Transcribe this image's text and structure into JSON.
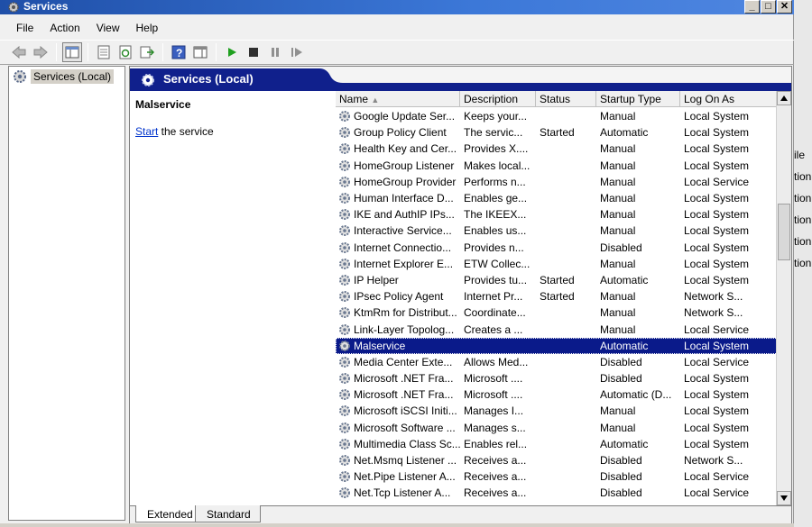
{
  "window": {
    "title": "Services"
  },
  "menu": [
    "File",
    "Action",
    "View",
    "Help"
  ],
  "tree": {
    "root_label": "Services (Local)"
  },
  "panel": {
    "header_title": "Services (Local)",
    "selected_service": "Malservice",
    "action_link": "Start",
    "action_rest": " the service"
  },
  "columns": [
    "Name",
    "Description",
    "Status",
    "Startup Type",
    "Log On As"
  ],
  "rows": [
    {
      "name": "Google Update Ser...",
      "desc": "Keeps your...",
      "status": "",
      "startup": "Manual",
      "logon": "Local System"
    },
    {
      "name": "Group Policy Client",
      "desc": "The servic...",
      "status": "Started",
      "startup": "Automatic",
      "logon": "Local System"
    },
    {
      "name": "Health Key and Cer...",
      "desc": "Provides X....",
      "status": "",
      "startup": "Manual",
      "logon": "Local System"
    },
    {
      "name": "HomeGroup Listener",
      "desc": "Makes local...",
      "status": "",
      "startup": "Manual",
      "logon": "Local System"
    },
    {
      "name": "HomeGroup Provider",
      "desc": "Performs n...",
      "status": "",
      "startup": "Manual",
      "logon": "Local Service"
    },
    {
      "name": "Human Interface D...",
      "desc": "Enables ge...",
      "status": "",
      "startup": "Manual",
      "logon": "Local System"
    },
    {
      "name": "IKE and AuthIP IPs...",
      "desc": "The IKEEX...",
      "status": "",
      "startup": "Manual",
      "logon": "Local System"
    },
    {
      "name": "Interactive Service...",
      "desc": "Enables us...",
      "status": "",
      "startup": "Manual",
      "logon": "Local System"
    },
    {
      "name": "Internet Connectio...",
      "desc": "Provides n...",
      "status": "",
      "startup": "Disabled",
      "logon": "Local System"
    },
    {
      "name": "Internet Explorer E...",
      "desc": "ETW Collec...",
      "status": "",
      "startup": "Manual",
      "logon": "Local System"
    },
    {
      "name": "IP Helper",
      "desc": "Provides tu...",
      "status": "Started",
      "startup": "Automatic",
      "logon": "Local System"
    },
    {
      "name": "IPsec Policy Agent",
      "desc": "Internet Pr...",
      "status": "Started",
      "startup": "Manual",
      "logon": "Network S..."
    },
    {
      "name": "KtmRm for Distribut...",
      "desc": "Coordinate...",
      "status": "",
      "startup": "Manual",
      "logon": "Network S..."
    },
    {
      "name": "Link-Layer Topolog...",
      "desc": "Creates a ...",
      "status": "",
      "startup": "Manual",
      "logon": "Local Service"
    },
    {
      "name": "Malservice",
      "desc": "",
      "status": "",
      "startup": "Automatic",
      "logon": "Local System",
      "selected": true
    },
    {
      "name": "Media Center Exte...",
      "desc": "Allows Med...",
      "status": "",
      "startup": "Disabled",
      "logon": "Local Service"
    },
    {
      "name": "Microsoft .NET Fra...",
      "desc": "Microsoft ....",
      "status": "",
      "startup": "Disabled",
      "logon": "Local System"
    },
    {
      "name": "Microsoft .NET Fra...",
      "desc": "Microsoft ....",
      "status": "",
      "startup": "Automatic (D...",
      "logon": "Local System"
    },
    {
      "name": "Microsoft iSCSI Initi...",
      "desc": "Manages I...",
      "status": "",
      "startup": "Manual",
      "logon": "Local System"
    },
    {
      "name": "Microsoft Software ...",
      "desc": "Manages s...",
      "status": "",
      "startup": "Manual",
      "logon": "Local System"
    },
    {
      "name": "Multimedia Class Sc...",
      "desc": "Enables rel...",
      "status": "",
      "startup": "Automatic",
      "logon": "Local System"
    },
    {
      "name": "Net.Msmq Listener ...",
      "desc": "Receives a...",
      "status": "",
      "startup": "Disabled",
      "logon": "Network S..."
    },
    {
      "name": "Net.Pipe Listener A...",
      "desc": "Receives a...",
      "status": "",
      "startup": "Disabled",
      "logon": "Local Service"
    },
    {
      "name": "Net.Tcp Listener A...",
      "desc": "Receives a...",
      "status": "",
      "startup": "Disabled",
      "logon": "Local Service"
    }
  ],
  "tabs": [
    "Extended",
    "Standard"
  ],
  "background_fragments": [
    "ile",
    "tion",
    "tion",
    "tion",
    "tion",
    "tion"
  ],
  "colors": {
    "title_blue": "#1f4fa8",
    "header_blue": "#10208c",
    "selected_row": "#0a1a8a",
    "link": "#0033cc"
  }
}
